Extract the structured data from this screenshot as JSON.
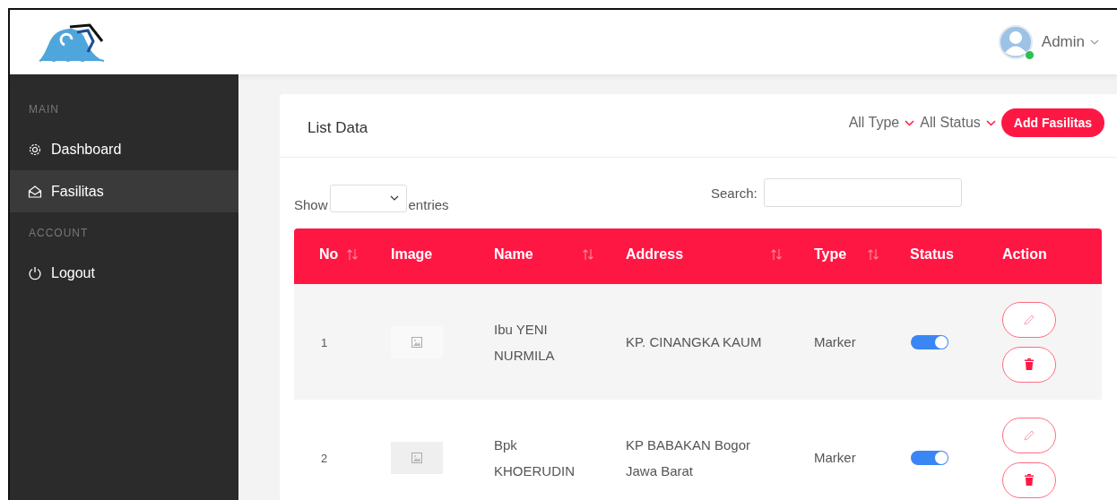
{
  "header": {
    "user": {
      "name": "Admin",
      "online": true
    }
  },
  "sidebar": {
    "sections": [
      {
        "heading": "MAIN",
        "items": [
          {
            "label": "Dashboard",
            "selected": false
          },
          {
            "label": "Fasilitas",
            "selected": true
          }
        ]
      },
      {
        "heading": "ACCOUNT",
        "items": [
          {
            "label": "Logout",
            "selected": false
          }
        ]
      }
    ]
  },
  "card": {
    "title": "List Data",
    "filters": [
      "All Type",
      "All Status"
    ],
    "add_button": "Add Fasilitas",
    "show_label": "Show",
    "entries_label": "entries",
    "search_label": "Search:"
  },
  "table": {
    "columns": [
      {
        "label": "No",
        "sortable": true
      },
      {
        "label": "Image",
        "sortable": false
      },
      {
        "label": "Name",
        "sortable": true
      },
      {
        "label": "Address",
        "sortable": true
      },
      {
        "label": "Type",
        "sortable": true
      },
      {
        "label": "Status",
        "sortable": false
      },
      {
        "label": "Action",
        "sortable": false
      }
    ],
    "rows": [
      {
        "no": "1",
        "name": "Ibu YENI NURMILA",
        "address": "KP. CINANGKA KAUM",
        "type": "Marker",
        "status": true
      },
      {
        "no": "2",
        "name": "Bpk KHOERUDIN",
        "address": "KP BABAKAN Bogor Jawa Barat",
        "type": "Marker",
        "status": true
      }
    ]
  }
}
